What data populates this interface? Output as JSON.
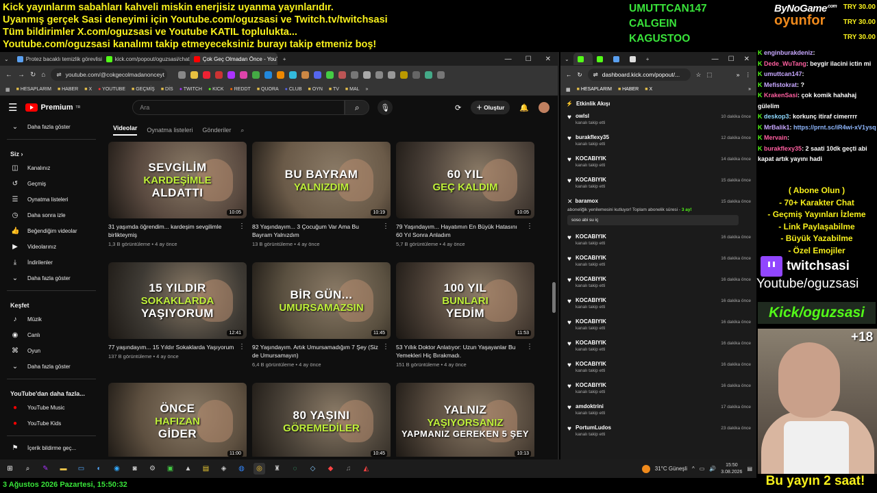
{
  "overlay": {
    "banner": [
      "Kick yayınlarım sabahları kahveli miskin enerjisiz uyanma yayınlarıdır.",
      "Uyanmış gerçek Sasi deneyimi için Youtube.com/oguzsasi ve Twitch.tv/twitchsasi",
      "Tüm bildirimler X.com/oguzsasi ve Youtube KATIL toplulukta...",
      "Youtube.com/oguzsasi kanalımı takip etmeyeceksiniz burayı takip etmeniz boş!"
    ],
    "subs": [
      "UMUTTCAN147",
      "CALGEIN",
      "KAGUSTOO"
    ],
    "sponsor_top": "ByNoGame",
    "sponsor_dotcom": ".com",
    "sponsor_bottom": "oyunfor",
    "tries": [
      "TRY 30.00",
      "TRY 30.00",
      "TRY 30.00"
    ],
    "promo": [
      "( Abone Olun )",
      "- 70+ Karakter Chat",
      "- Geçmiş Yayınları İzleme",
      "- Link Paylaşabilme",
      "- Büyük Yazabilme",
      "- Özel Emojiler"
    ],
    "twitch": "twitchsasi",
    "youtube": "Youtube/oguzsasi",
    "kick": "Kick/oguzsasi",
    "viewers": "+18",
    "duration_note": "Bu yayın 2 saat!",
    "datetime": "3 Ağustos 2026 Pazartesi, 15:50:32"
  },
  "chat": [
    {
      "user": "enginburakdeniz",
      "text": ":"
    },
    {
      "user": "Dede_WuTang",
      "text": ": beygir ilacini ictin mi"
    },
    {
      "user": "umuttcan147",
      "text": ":"
    },
    {
      "user": "Mefistokrat",
      "text": ": ?"
    },
    {
      "user": "KrakenSasi",
      "text": ": çok komik hahahaj gülelim"
    },
    {
      "user": "deskop3",
      "text": ": korkunç itiraf cimerrrr"
    },
    {
      "user": "MrBalik1",
      "text": ": ",
      "link": "https://prnt.sc/iR4wi-xV1ysq"
    },
    {
      "user": "Mervain",
      "text": ":"
    },
    {
      "user": "burakflexy35",
      "text": ": 2 saati 10dk geçti abi kapat artık yayını hadi"
    }
  ],
  "left_browser": {
    "tabs": [
      "Protez bacaklı temizlik görevlisi",
      "kick.com/popout/oguzsasi/chat",
      "Çok Geç Olmadan Önce - YouTube"
    ],
    "url": "youtube.com/@cokgecolmadanonceyt",
    "bookmarks": [
      "HESAPLARIM",
      "HABER",
      "X",
      "YOUTUBE",
      "GEÇMİŞ",
      "DİS",
      "TWITCH",
      "KICK",
      "REDDT",
      "QUORA",
      "CLUB",
      "OYN",
      "TV",
      "MAL"
    ],
    "yt_brand": "Premium",
    "yt_tr": "TR",
    "search_placeholder": "Ara",
    "create": "Oluştur",
    "sidebar": {
      "more1": "Daha fazla göster",
      "you": "Siz",
      "you_items": [
        "Kanalınız",
        "Geçmiş",
        "Oynatma listeleri",
        "Daha sonra izle",
        "Beğendiğim videolar",
        "Videolarınız",
        "İndirilenler",
        "Daha fazla göster"
      ],
      "explore": "Keşfet",
      "explore_items": [
        "Müzik",
        "Canlı",
        "Oyun",
        "Daha fazla göster"
      ],
      "more_yt": "YouTube'dan daha fazla...",
      "more_yt_items": [
        "YouTube Music",
        "YouTube Kids"
      ],
      "report": "İçerik bildirme geç..."
    },
    "channel_tabs": [
      "Videolar",
      "Oynatma listeleri",
      "Gönderiler"
    ],
    "videos": [
      {
        "l1": "SEVGİLİM",
        "l2": "KARDEŞİMLE",
        "l3": "ALDATTI",
        "dur": "10:05",
        "title": "31 yaşımda öğrendim... kardeşim sevgilimle birlikteymiş",
        "meta": "1,3 B görüntüleme • 4 ay önce",
        "bg": "#5a4a40"
      },
      {
        "l1": "BU BAYRAM",
        "l2": "YALNIZDIM",
        "l3": "",
        "dur": "10:19",
        "title": "83 Yaşındayım... 3 Çocuğum Var Ama Bu Bayram Yalnızdım",
        "meta": "13 B görüntüleme • 4 ay önce",
        "bg": "#6a5a48"
      },
      {
        "l1": "60 YIL",
        "l2": "GEÇ KALDIM",
        "l3": "",
        "dur": "10:05",
        "title": "79 Yaşındayım... Hayatımın En Büyük Hatasını 60 Yıl Sonra Anladım",
        "meta": "5,7 B görüntüleme • 4 ay önce",
        "bg": "#4a4038"
      },
      {
        "l1": "15 YILDIR",
        "l2": "SOKAKLARDA",
        "l3": "YAŞIYORUM",
        "dur": "12:41",
        "title": "77 yaşındayım... 15 Yıldır Sokaklarda Yaşıyorum",
        "meta": "137 B görüntüleme • 4 ay önce",
        "bg": "#3e3a34"
      },
      {
        "l1": "BİR GÜN...",
        "l2": "UMURSAMAZSIN",
        "l3": "",
        "dur": "11:45",
        "title": "92 Yaşındayım. Artık Umursamadığım 7 Şey (Siz de Umursamayın)",
        "meta": "6,4 B görüntüleme • 4 ay önce",
        "bg": "#5a5040"
      },
      {
        "l1": "100 YIL",
        "l2": "BUNLARI",
        "l3": "YEDİM",
        "dur": "11:53",
        "title": "53 Yıllık Doktor Anlatıyor: Uzun Yaşayanlar Bu Yemekleri Hiç Bırakmadı.",
        "meta": "151 B görüntüleme • 4 ay önce",
        "bg": "#4e4238"
      },
      {
        "l1": "ÖNCE",
        "l2": "HAFIZAN",
        "l3": "GİDER",
        "dur": "11:00",
        "title": "",
        "meta": "",
        "bg": "#5e5040"
      },
      {
        "l1": "80 YAŞINI",
        "l2": "GÖREMEDİLER",
        "l3": "",
        "dur": "10:45",
        "title": "",
        "meta": "",
        "bg": "#4a4238"
      },
      {
        "l1": "YALNIZ",
        "l2": "YAŞIYORSANIZ",
        "l3": "YAPMANIZ GEREKEN 5 ŞEY",
        "dur": "10:13",
        "title": "",
        "meta": "",
        "bg": "#54483c"
      }
    ]
  },
  "kick_browser": {
    "url": "dashboard.kick.com/popout/...",
    "bookmarks": [
      "HESAPLARIM",
      "HABER",
      "X"
    ],
    "feed_title": "Etkinlik Akışı",
    "events": [
      {
        "name": "owlsl",
        "sub": "kanalı takip etti",
        "time": "10 dakika önce"
      },
      {
        "name": "burakflexy35",
        "sub": "kanalı takip etti",
        "time": "12 dakika önce"
      },
      {
        "name": "KOCABIYIK",
        "sub": "kanalı takip etti",
        "time": "14 dakika önce"
      },
      {
        "name": "KOCABIYIK",
        "sub": "kanalı takip etti",
        "time": "15 dakika önce"
      }
    ],
    "subscription": {
      "name": "baramox",
      "time": "15 dakika önce",
      "msg": "aboneliğik yenilemesini kutluyor! Toplam abonelik süresi - ",
      "months": "3 ay!",
      "quote": "soso abi su iç"
    },
    "events2": [
      {
        "name": "KOCABIYIK",
        "sub": "kanalı takip etti",
        "time": "16 dakika önce"
      },
      {
        "name": "KOCABIYIK",
        "sub": "kanalı takip etti",
        "time": "16 dakika önce"
      },
      {
        "name": "KOCABIYIK",
        "sub": "kanalı takip etti",
        "time": "16 dakika önce"
      },
      {
        "name": "KOCABIYIK",
        "sub": "kanalı takip etti",
        "time": "16 dakika önce"
      },
      {
        "name": "KOCABIYIK",
        "sub": "kanalı takip etti",
        "time": "16 dakika önce"
      },
      {
        "name": "KOCABIYIK",
        "sub": "kanalı takip etti",
        "time": "16 dakika önce"
      },
      {
        "name": "KOCABIYIK",
        "sub": "kanalı takip etti",
        "time": "16 dakika önce"
      },
      {
        "name": "KOCABIYIK",
        "sub": "kanalı takip etti",
        "time": "16 dakika önce"
      },
      {
        "name": "amdoktrini",
        "sub": "kanalı takip etti",
        "time": "17 dakika önce"
      },
      {
        "name": "PortumLudos",
        "sub": "kanalı takip etti",
        "time": "23 dakika önce"
      }
    ]
  },
  "taskbar": {
    "weather": "31°C  Güneşli",
    "time": "15:50",
    "date": "3.08.2026"
  }
}
